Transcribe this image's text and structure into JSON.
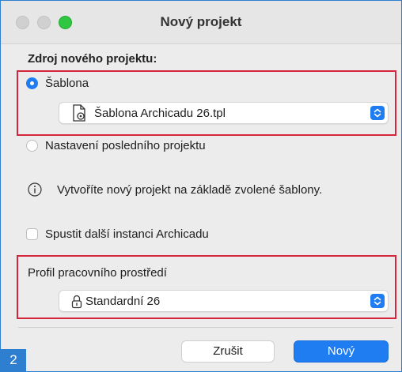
{
  "window": {
    "title": "Nový projekt"
  },
  "source": {
    "heading": "Zdroj nového projektu:",
    "template_option": "Šablona",
    "template_file": "Šablona Archicadu 26.tpl",
    "last_project_option": "Nastavení posledního projektu",
    "info_text": "Vytvoříte nový projekt na základě zvolené šablony.",
    "template_selected": true,
    "last_project_selected": false
  },
  "instance": {
    "label": "Spustit další instanci Archicadu",
    "checked": false
  },
  "profile": {
    "heading": "Profil pracovního prostředí",
    "value": "Standardní 26"
  },
  "buttons": {
    "cancel": "Zrušit",
    "create": "Nový"
  },
  "badge": "2",
  "colors": {
    "accent": "#1f7cf1",
    "highlight_box": "#d6263b",
    "badge_bg": "#2f7fd1"
  }
}
